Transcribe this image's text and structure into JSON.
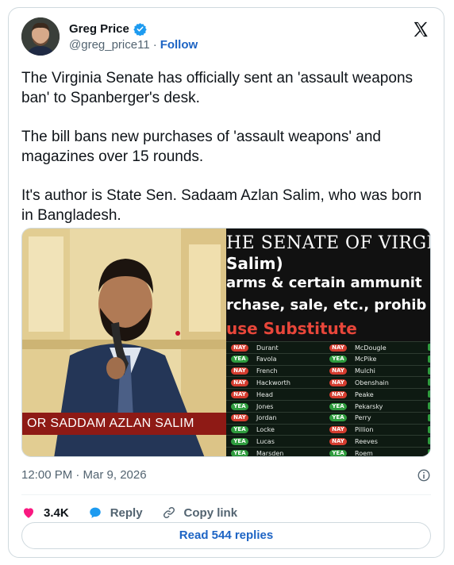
{
  "author": {
    "name": "Greg Price",
    "handle": "@greg_price11",
    "separator": "·",
    "follow_label": "Follow",
    "verified_color": "#1d9bf0"
  },
  "tweet": {
    "paragraphs": [
      "The Virginia Senate has officially sent an 'assault weapons ban' to Spanberger's desk.",
      "The bill bans new purchases of 'assault weapons' and magazines over 15 rounds.",
      "It's author is State Sen. Sadaam Azlan Salim, who was born in Bangladesh."
    ]
  },
  "media": {
    "left_caption": "OR SADDAM AZLAN SALIM",
    "screen_lines": [
      "HE SENATE OF VIRGIN",
      "Salim)",
      "arms & certain ammunit",
      "rchase, sale, etc., prohib",
      "use Substitute"
    ],
    "votes_left": [
      {
        "vote": "NAY",
        "name": "Durant"
      },
      {
        "vote": "YEA",
        "name": "Favola"
      },
      {
        "vote": "NAY",
        "name": "French"
      },
      {
        "vote": "NAY",
        "name": "Hackworth"
      },
      {
        "vote": "NAY",
        "name": "Head"
      },
      {
        "vote": "YEA",
        "name": "Jones"
      },
      {
        "vote": "NAY",
        "name": "Jordan"
      },
      {
        "vote": "YEA",
        "name": "Locke"
      },
      {
        "vote": "YEA",
        "name": "Lucas"
      },
      {
        "vote": "YEA",
        "name": "Marsden"
      }
    ],
    "votes_right": [
      {
        "vote": "NAY",
        "name": "McDougle"
      },
      {
        "vote": "YEA",
        "name": "McPike"
      },
      {
        "vote": "NAY",
        "name": "Mulchi"
      },
      {
        "vote": "NAY",
        "name": "Obenshain"
      },
      {
        "vote": "NAY",
        "name": "Peake"
      },
      {
        "vote": "YEA",
        "name": "Pekarsky"
      },
      {
        "vote": "YEA",
        "name": "Perry"
      },
      {
        "vote": "NAY",
        "name": "Pillion"
      },
      {
        "vote": "NAY",
        "name": "Reeves"
      },
      {
        "vote": "YEA",
        "name": "Roem"
      }
    ]
  },
  "meta": {
    "timestamp": "12:00 PM · Mar 9, 2026"
  },
  "actions": {
    "like_count": "3.4K",
    "reply_label": "Reply",
    "copy_label": "Copy link",
    "like_color": "#f91880",
    "reply_color": "#1d9bf0"
  },
  "replies_button": "Read 544 replies"
}
